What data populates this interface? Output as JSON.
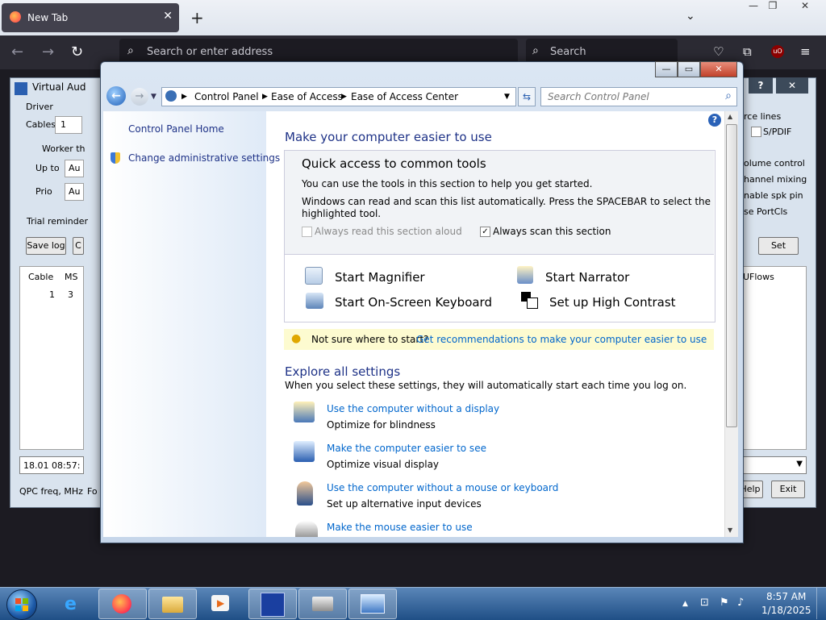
{
  "firefox": {
    "tab_title": "New Tab",
    "tab_close": "✕",
    "new_tab": "+",
    "list_all": "⌄",
    "url_placeholder": "Search or enter address",
    "search_placeholder": "Search",
    "window_min": "—",
    "window_max": "❐",
    "window_close": "✕"
  },
  "vac": {
    "title": "Virtual Aud",
    "driver": "Driver",
    "cables_label": "Cables",
    "cables_value": "1",
    "worker": "Worker th",
    "upto": "Up to",
    "upto_value": "Au",
    "prio": "Prio",
    "prio_value": "Au",
    "trial": "Trial reminder",
    "save_log": "Save log",
    "list_cols": [
      "Cable",
      "MS"
    ],
    "list_row": [
      "1",
      "3"
    ],
    "status": "18.01  08:57:",
    "qpc": "QPC freq, MHz",
    "right_labels": [
      "rce lines",
      "S/PDIF",
      "olume control",
      "hannel mixing",
      "nable spk pin",
      "se PortCls"
    ],
    "set": "Set",
    "uflows": "UFlows",
    "help": "Help",
    "exit": "Exit",
    "question": "?",
    "close": "✕",
    "fo": "Fo"
  },
  "cp": {
    "breadcrumb": [
      "Control Panel",
      "Ease of Access",
      "Ease of Access Center"
    ],
    "search_placeholder": "Search Control Panel",
    "left_home": "Control Panel Home",
    "left_admin": "Change administrative settings",
    "heading": "Make your computer easier to use",
    "qa_title": "Quick access to common tools",
    "qa_line1": "You can use the tools in this section to help you get started.",
    "qa_line2": "Windows can read and scan this list automatically.  Press the SPACEBAR to select the",
    "qa_line3": "highlighted tool.",
    "cb_read": "Always read this section aloud",
    "cb_scan": "Always scan this section",
    "tools": [
      "Start Magnifier",
      "Start Narrator",
      "Start On-Screen Keyboard",
      "Set up High Contrast"
    ],
    "tip_question": "Not sure where to start?",
    "tip_link": "Get recommendations to make your computer easier to use",
    "explore_title": "Explore all settings",
    "explore_desc": "When you select these settings, they will automatically start each time you log on.",
    "settings": [
      {
        "link": "Use the computer without a display",
        "desc": "Optimize for blindness"
      },
      {
        "link": "Make the computer easier to see",
        "desc": "Optimize visual display"
      },
      {
        "link": "Use the computer without a mouse or keyboard",
        "desc": "Set up alternative input devices"
      },
      {
        "link": "Make the mouse easier to use",
        "desc": ""
      }
    ],
    "help_icon": "?"
  },
  "taskbar": {
    "time": "8:57 AM",
    "date": "1/18/2025"
  }
}
